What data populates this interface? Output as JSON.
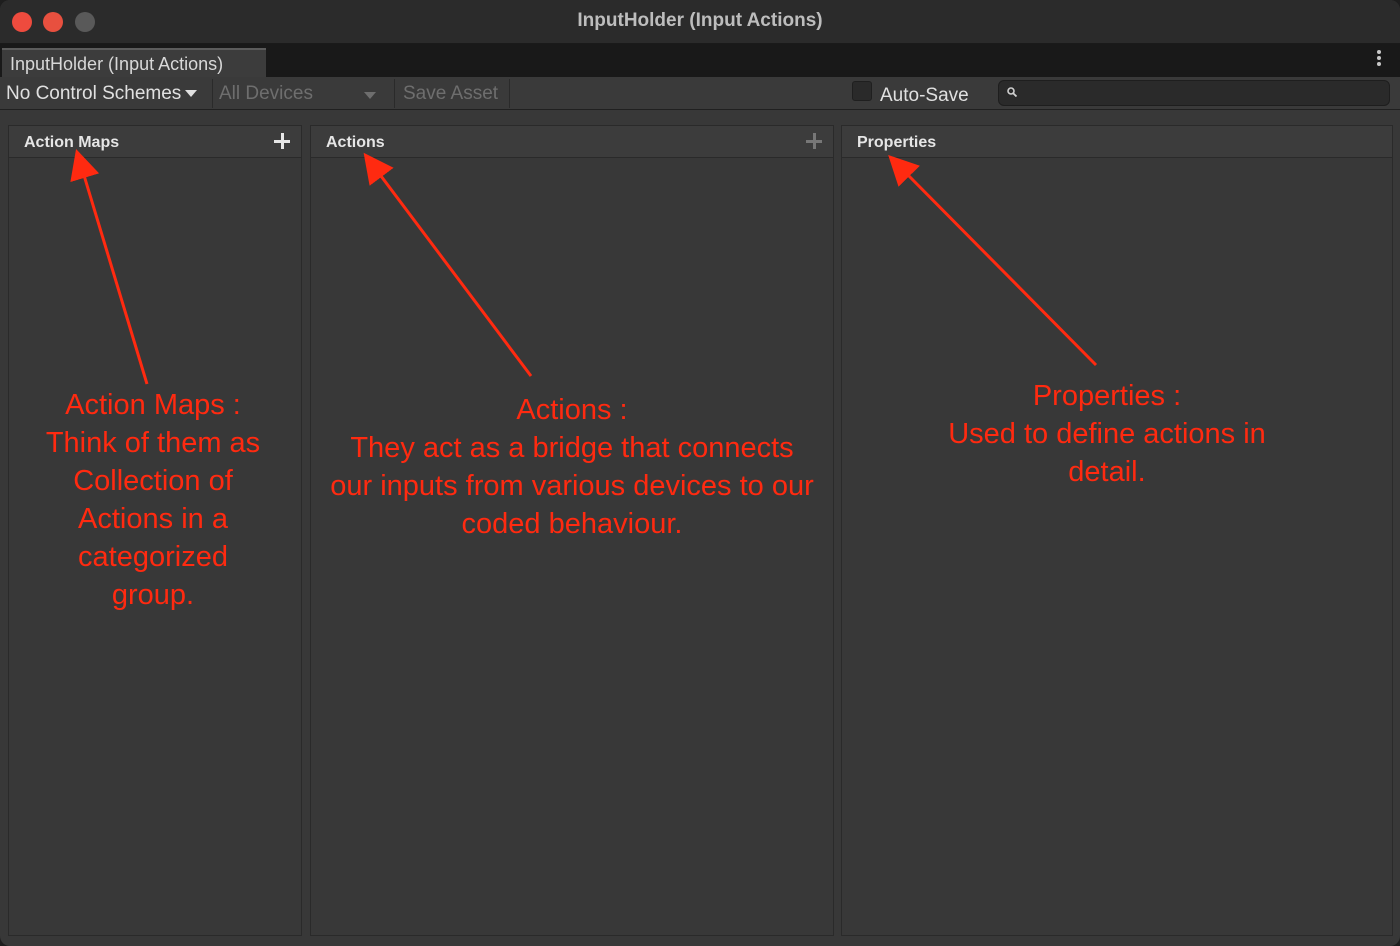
{
  "window": {
    "title": "InputHolder (Input Actions)"
  },
  "tab": {
    "label": "InputHolder (Input Actions)"
  },
  "toolbar": {
    "control_schemes": "No Control Schemes",
    "devices": "All Devices",
    "save_asset": "Save Asset",
    "auto_save_label": "Auto-Save",
    "auto_save_checked": false,
    "search_value": ""
  },
  "panes": {
    "action_maps": "Action Maps",
    "actions": "Actions",
    "properties": "Properties"
  },
  "annotations": {
    "action_maps": [
      "Action Maps :",
      "Think of them as",
      "Collection of",
      "Actions in a",
      "categorized",
      "group."
    ],
    "actions": [
      "Actions :",
      "They act as a bridge that connects",
      "our inputs from various devices to our",
      "coded behaviour."
    ],
    "properties": [
      "Properties :",
      "Used to define actions in",
      "detail."
    ]
  },
  "colors": {
    "annotation": "#ff2a10",
    "close": "#ee4b3e",
    "minimize": "#e8503f",
    "maximize": "#595959"
  }
}
